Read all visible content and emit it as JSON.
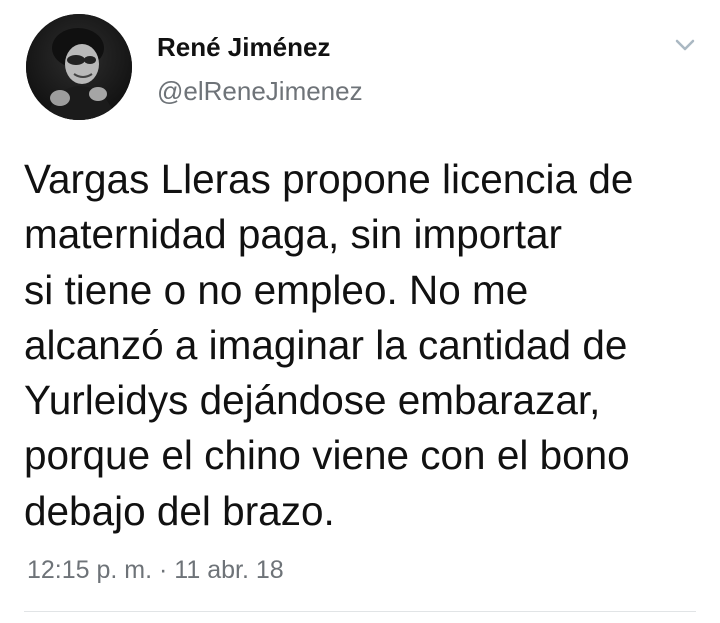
{
  "tweet": {
    "author": {
      "display_name": "René Jiménez",
      "handle": "@elReneJimenez"
    },
    "text": "Vargas Lleras propone licencia de\nmaternidad paga, sin importar\nsi tiene o no empleo. No me\nalcanzó a imaginar la cantidad de\nYurleidys dejándose embarazar,\nporque el chino viene con el bono\ndebajo del brazo.",
    "timestamp": "12:15 p. m. · 11 abr. 18",
    "menu_icon": "chevron-down-icon"
  },
  "colors": {
    "text": "#111111",
    "secondary_text": "#6e7378",
    "divider": "#e1e4e6",
    "background": "#ffffff"
  }
}
